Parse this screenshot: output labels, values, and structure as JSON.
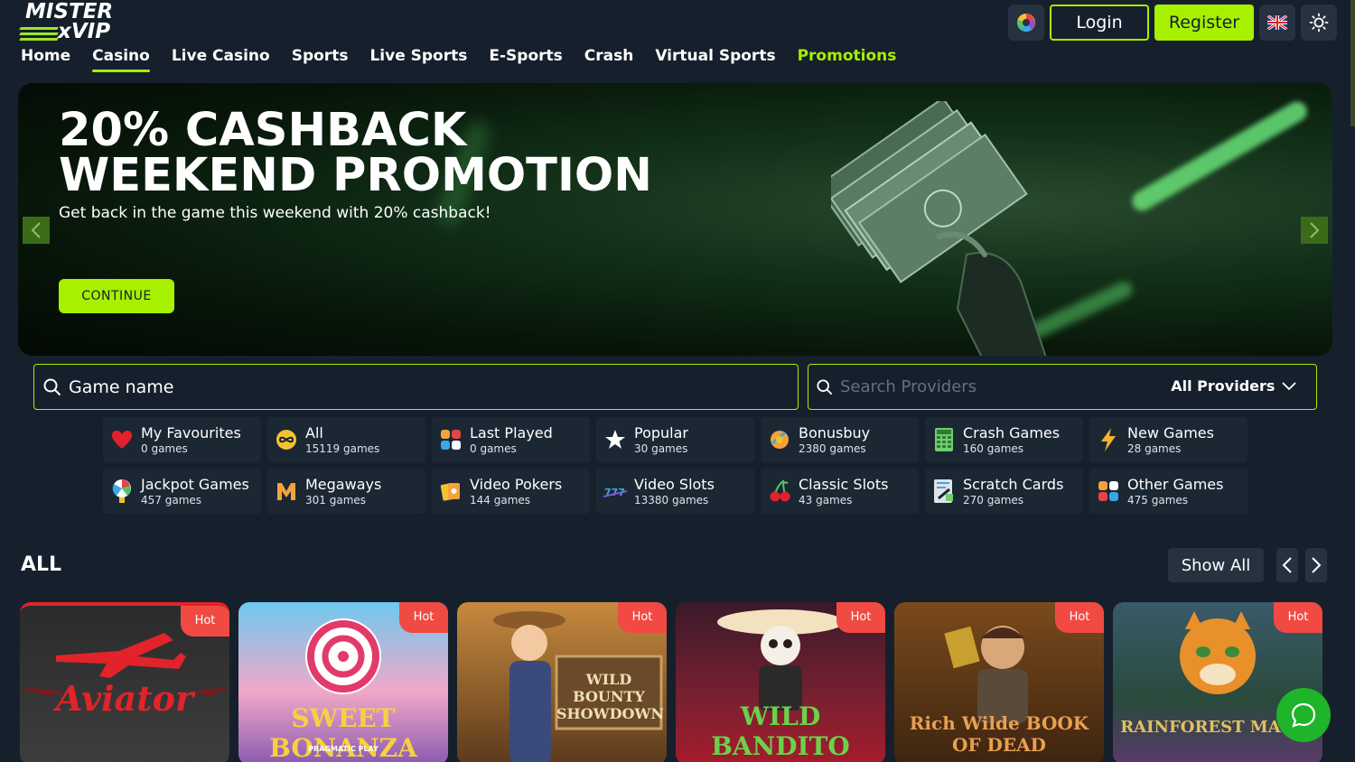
{
  "brand": {
    "line1": "MISTER",
    "line2": "xVIP",
    "accent": "#a6f000"
  },
  "header": {
    "login_label": "Login",
    "register_label": "Register",
    "icons": [
      "color-wheel-icon",
      "uk-flag-icon",
      "brightness-icon"
    ]
  },
  "nav": {
    "items": [
      {
        "label": "Home"
      },
      {
        "label": "Casino"
      },
      {
        "label": "Live Casino"
      },
      {
        "label": "Sports"
      },
      {
        "label": "Live Sports"
      },
      {
        "label": "E-Sports"
      },
      {
        "label": "Crash"
      },
      {
        "label": "Virtual Sports"
      },
      {
        "label": "Promotions"
      }
    ],
    "active": "Casino"
  },
  "banner": {
    "title_line1": "20% CASHBACK",
    "title_line2": "WEEKEND PROMOTION",
    "subtitle": "Get back in the game this weekend with 20% cashback!",
    "cta_label": "CONTINUE"
  },
  "search": {
    "game_placeholder": "Game name",
    "provider_placeholder": "Search Providers",
    "provider_filter": "All Providers"
  },
  "categories": [
    {
      "name": "My Favourites",
      "count": "0 games",
      "icon": "heart-icon"
    },
    {
      "name": "All",
      "count": "15119 games",
      "icon": "infinity-icon"
    },
    {
      "name": "Last Played",
      "count": "0 games",
      "icon": "grid-icon"
    },
    {
      "name": "Popular",
      "count": "30 games",
      "icon": "star-icon"
    },
    {
      "name": "Bonusbuy",
      "count": "2380 games",
      "icon": "coin-icon"
    },
    {
      "name": "Crash Games",
      "count": "160 games",
      "icon": "calculator-icon"
    },
    {
      "name": "New Games",
      "count": "28 games",
      "icon": "lightning-icon"
    },
    {
      "name": "Jackpot Games",
      "count": "457 games",
      "icon": "wheel-icon"
    },
    {
      "name": "Megaways",
      "count": "301 games",
      "icon": "megaways-icon"
    },
    {
      "name": "Video Pokers",
      "count": "144 games",
      "icon": "cards-icon"
    },
    {
      "name": "Video Slots",
      "count": "13380 games",
      "icon": "slot-777-icon"
    },
    {
      "name": "Classic Slots",
      "count": "43 games",
      "icon": "cherry-icon"
    },
    {
      "name": "Scratch Cards",
      "count": "270 games",
      "icon": "scratch-card-icon"
    },
    {
      "name": "Other Games",
      "count": "475 games",
      "icon": "grid-icon"
    }
  ],
  "section": {
    "title": "ALL",
    "show_all_label": "Show All"
  },
  "games": [
    {
      "title": "Aviator",
      "badge": "Hot"
    },
    {
      "title": "SWEET BONANZA",
      "provider": "PRAGMATIC PLAY",
      "badge": "Hot"
    },
    {
      "title": "WILD BOUNTY SHOWDOWN",
      "badge": "Hot"
    },
    {
      "title": "WILD BANDITO",
      "badge": "Hot"
    },
    {
      "title": "Rich Wilde BOOK OF DEAD",
      "badge": "Hot"
    },
    {
      "title": "RAINFOREST MAGIC",
      "badge": "Hot"
    }
  ]
}
